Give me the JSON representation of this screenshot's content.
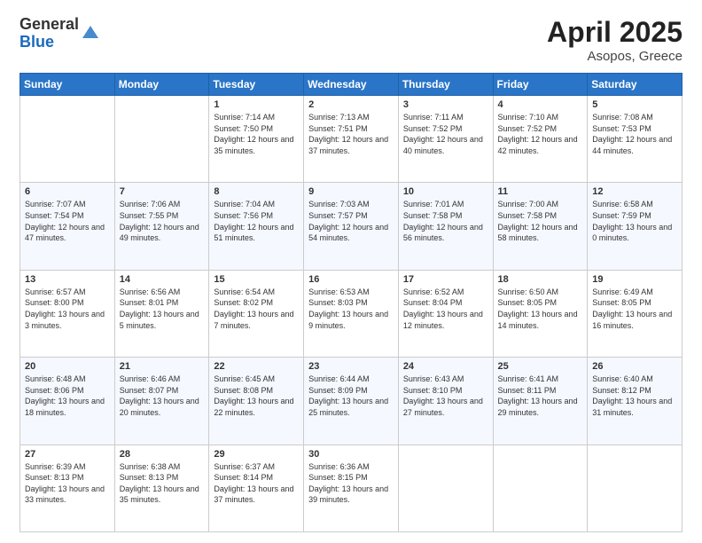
{
  "logo": {
    "general": "General",
    "blue": "Blue"
  },
  "title": {
    "month_year": "April 2025",
    "location": "Asopos, Greece"
  },
  "days_of_week": [
    "Sunday",
    "Monday",
    "Tuesday",
    "Wednesday",
    "Thursday",
    "Friday",
    "Saturday"
  ],
  "weeks": [
    [
      {
        "day": "",
        "info": ""
      },
      {
        "day": "",
        "info": ""
      },
      {
        "day": "1",
        "info": "Sunrise: 7:14 AM\nSunset: 7:50 PM\nDaylight: 12 hours and 35 minutes."
      },
      {
        "day": "2",
        "info": "Sunrise: 7:13 AM\nSunset: 7:51 PM\nDaylight: 12 hours and 37 minutes."
      },
      {
        "day": "3",
        "info": "Sunrise: 7:11 AM\nSunset: 7:52 PM\nDaylight: 12 hours and 40 minutes."
      },
      {
        "day": "4",
        "info": "Sunrise: 7:10 AM\nSunset: 7:52 PM\nDaylight: 12 hours and 42 minutes."
      },
      {
        "day": "5",
        "info": "Sunrise: 7:08 AM\nSunset: 7:53 PM\nDaylight: 12 hours and 44 minutes."
      }
    ],
    [
      {
        "day": "6",
        "info": "Sunrise: 7:07 AM\nSunset: 7:54 PM\nDaylight: 12 hours and 47 minutes."
      },
      {
        "day": "7",
        "info": "Sunrise: 7:06 AM\nSunset: 7:55 PM\nDaylight: 12 hours and 49 minutes."
      },
      {
        "day": "8",
        "info": "Sunrise: 7:04 AM\nSunset: 7:56 PM\nDaylight: 12 hours and 51 minutes."
      },
      {
        "day": "9",
        "info": "Sunrise: 7:03 AM\nSunset: 7:57 PM\nDaylight: 12 hours and 54 minutes."
      },
      {
        "day": "10",
        "info": "Sunrise: 7:01 AM\nSunset: 7:58 PM\nDaylight: 12 hours and 56 minutes."
      },
      {
        "day": "11",
        "info": "Sunrise: 7:00 AM\nSunset: 7:58 PM\nDaylight: 12 hours and 58 minutes."
      },
      {
        "day": "12",
        "info": "Sunrise: 6:58 AM\nSunset: 7:59 PM\nDaylight: 13 hours and 0 minutes."
      }
    ],
    [
      {
        "day": "13",
        "info": "Sunrise: 6:57 AM\nSunset: 8:00 PM\nDaylight: 13 hours and 3 minutes."
      },
      {
        "day": "14",
        "info": "Sunrise: 6:56 AM\nSunset: 8:01 PM\nDaylight: 13 hours and 5 minutes."
      },
      {
        "day": "15",
        "info": "Sunrise: 6:54 AM\nSunset: 8:02 PM\nDaylight: 13 hours and 7 minutes."
      },
      {
        "day": "16",
        "info": "Sunrise: 6:53 AM\nSunset: 8:03 PM\nDaylight: 13 hours and 9 minutes."
      },
      {
        "day": "17",
        "info": "Sunrise: 6:52 AM\nSunset: 8:04 PM\nDaylight: 13 hours and 12 minutes."
      },
      {
        "day": "18",
        "info": "Sunrise: 6:50 AM\nSunset: 8:05 PM\nDaylight: 13 hours and 14 minutes."
      },
      {
        "day": "19",
        "info": "Sunrise: 6:49 AM\nSunset: 8:05 PM\nDaylight: 13 hours and 16 minutes."
      }
    ],
    [
      {
        "day": "20",
        "info": "Sunrise: 6:48 AM\nSunset: 8:06 PM\nDaylight: 13 hours and 18 minutes."
      },
      {
        "day": "21",
        "info": "Sunrise: 6:46 AM\nSunset: 8:07 PM\nDaylight: 13 hours and 20 minutes."
      },
      {
        "day": "22",
        "info": "Sunrise: 6:45 AM\nSunset: 8:08 PM\nDaylight: 13 hours and 22 minutes."
      },
      {
        "day": "23",
        "info": "Sunrise: 6:44 AM\nSunset: 8:09 PM\nDaylight: 13 hours and 25 minutes."
      },
      {
        "day": "24",
        "info": "Sunrise: 6:43 AM\nSunset: 8:10 PM\nDaylight: 13 hours and 27 minutes."
      },
      {
        "day": "25",
        "info": "Sunrise: 6:41 AM\nSunset: 8:11 PM\nDaylight: 13 hours and 29 minutes."
      },
      {
        "day": "26",
        "info": "Sunrise: 6:40 AM\nSunset: 8:12 PM\nDaylight: 13 hours and 31 minutes."
      }
    ],
    [
      {
        "day": "27",
        "info": "Sunrise: 6:39 AM\nSunset: 8:13 PM\nDaylight: 13 hours and 33 minutes."
      },
      {
        "day": "28",
        "info": "Sunrise: 6:38 AM\nSunset: 8:13 PM\nDaylight: 13 hours and 35 minutes."
      },
      {
        "day": "29",
        "info": "Sunrise: 6:37 AM\nSunset: 8:14 PM\nDaylight: 13 hours and 37 minutes."
      },
      {
        "day": "30",
        "info": "Sunrise: 6:36 AM\nSunset: 8:15 PM\nDaylight: 13 hours and 39 minutes."
      },
      {
        "day": "",
        "info": ""
      },
      {
        "day": "",
        "info": ""
      },
      {
        "day": "",
        "info": ""
      }
    ]
  ]
}
